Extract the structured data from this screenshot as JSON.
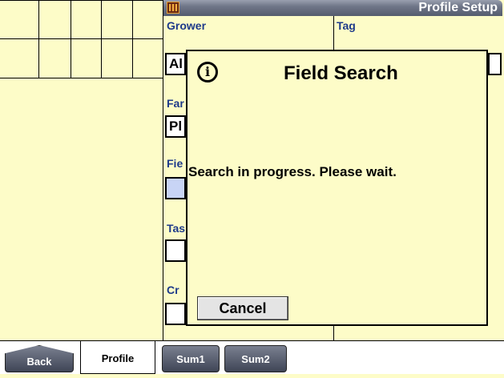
{
  "header": {
    "title": "Profile Setup",
    "app_icon": "screen-grid-icon"
  },
  "form": {
    "grower_label": "Grower",
    "grower_value": "Al",
    "tag_label": "Tag",
    "tag_value": "",
    "farm_label": "Far",
    "farm_value": "Pl",
    "field_label": "Fie",
    "field_value": "",
    "task_label": "Tas",
    "task_value": "",
    "crop_label": "Cr",
    "crop_value": ""
  },
  "dialog": {
    "icon": "info-icon",
    "title": "Field Search",
    "message": "Search in progress. Please wait.",
    "cancel_label": "Cancel"
  },
  "tabs": [
    {
      "label": "Back"
    },
    {
      "label": "Profile"
    },
    {
      "label": "Sum1"
    },
    {
      "label": "Sum2"
    }
  ],
  "colors": {
    "background": "#fdfcc8",
    "label_blue": "#1e3a8a",
    "field_highlight": "#c8d4f5",
    "titlebar": "#6f7688"
  }
}
